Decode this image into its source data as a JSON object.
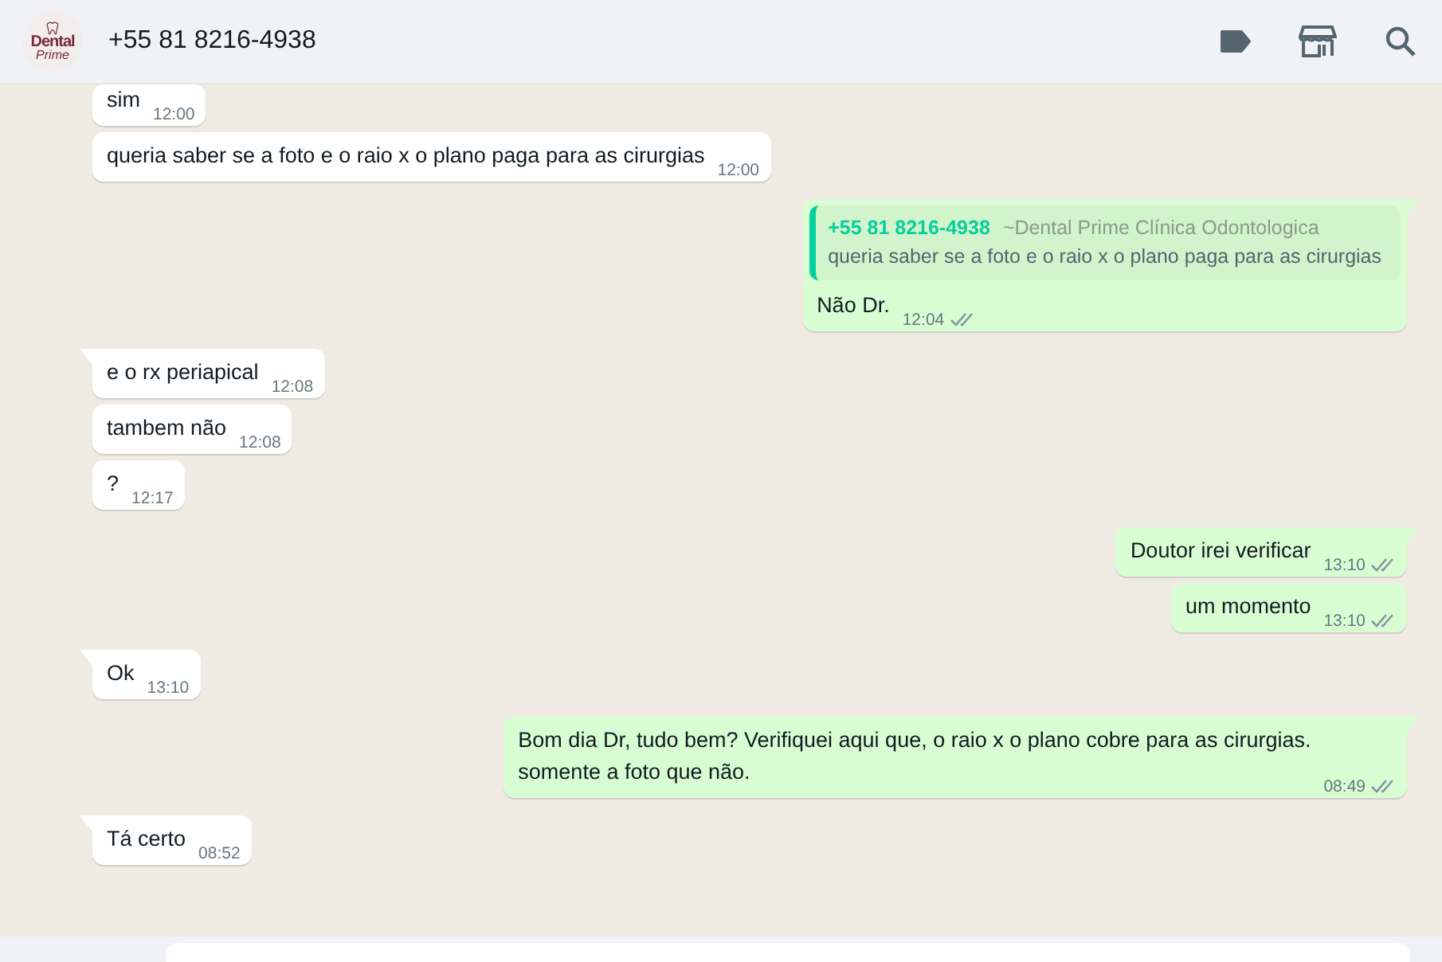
{
  "header": {
    "logo": {
      "line1": "Dental",
      "line2": "Prime"
    },
    "title": "+55 81 8216-4938"
  },
  "messages": [
    {
      "outgoing": false,
      "tail": false,
      "text": "sim",
      "time": "12:00"
    },
    {
      "outgoing": false,
      "tail": false,
      "text": "queria saber se a foto e o raio x o plano paga para as cirurgias",
      "time": "12:00"
    },
    {
      "outgoing": true,
      "tail": true,
      "quote": {
        "author": "+55 81 8216-4938",
        "name": "~Dental Prime Clínica Odontologica",
        "text": "queria saber se a foto e o raio x o plano paga para as cirurgias"
      },
      "text": "Não Dr.",
      "time": "12:04",
      "read": false
    },
    {
      "outgoing": false,
      "tail": true,
      "text": "e  o rx periapical",
      "time": "12:08"
    },
    {
      "outgoing": false,
      "tail": false,
      "text": "tambem não",
      "time": "12:08"
    },
    {
      "outgoing": false,
      "tail": false,
      "text": "?",
      "time": "12:17"
    },
    {
      "outgoing": true,
      "tail": true,
      "text": "Doutor irei verificar",
      "time": "13:10",
      "read": false
    },
    {
      "outgoing": true,
      "tail": false,
      "text": "um momento",
      "time": "13:10",
      "read": false
    },
    {
      "outgoing": false,
      "tail": true,
      "text": "Ok",
      "time": "13:10"
    },
    {
      "outgoing": true,
      "tail": true,
      "text": "Bom dia Dr, tudo bem? Verifiquei aqui que, o raio x o plano cobre para as cirurgias.\nsomente a foto que não.",
      "time": "08:49",
      "read": false
    },
    {
      "outgoing": false,
      "tail": true,
      "text": "Tá certo",
      "time": "08:52"
    }
  ]
}
